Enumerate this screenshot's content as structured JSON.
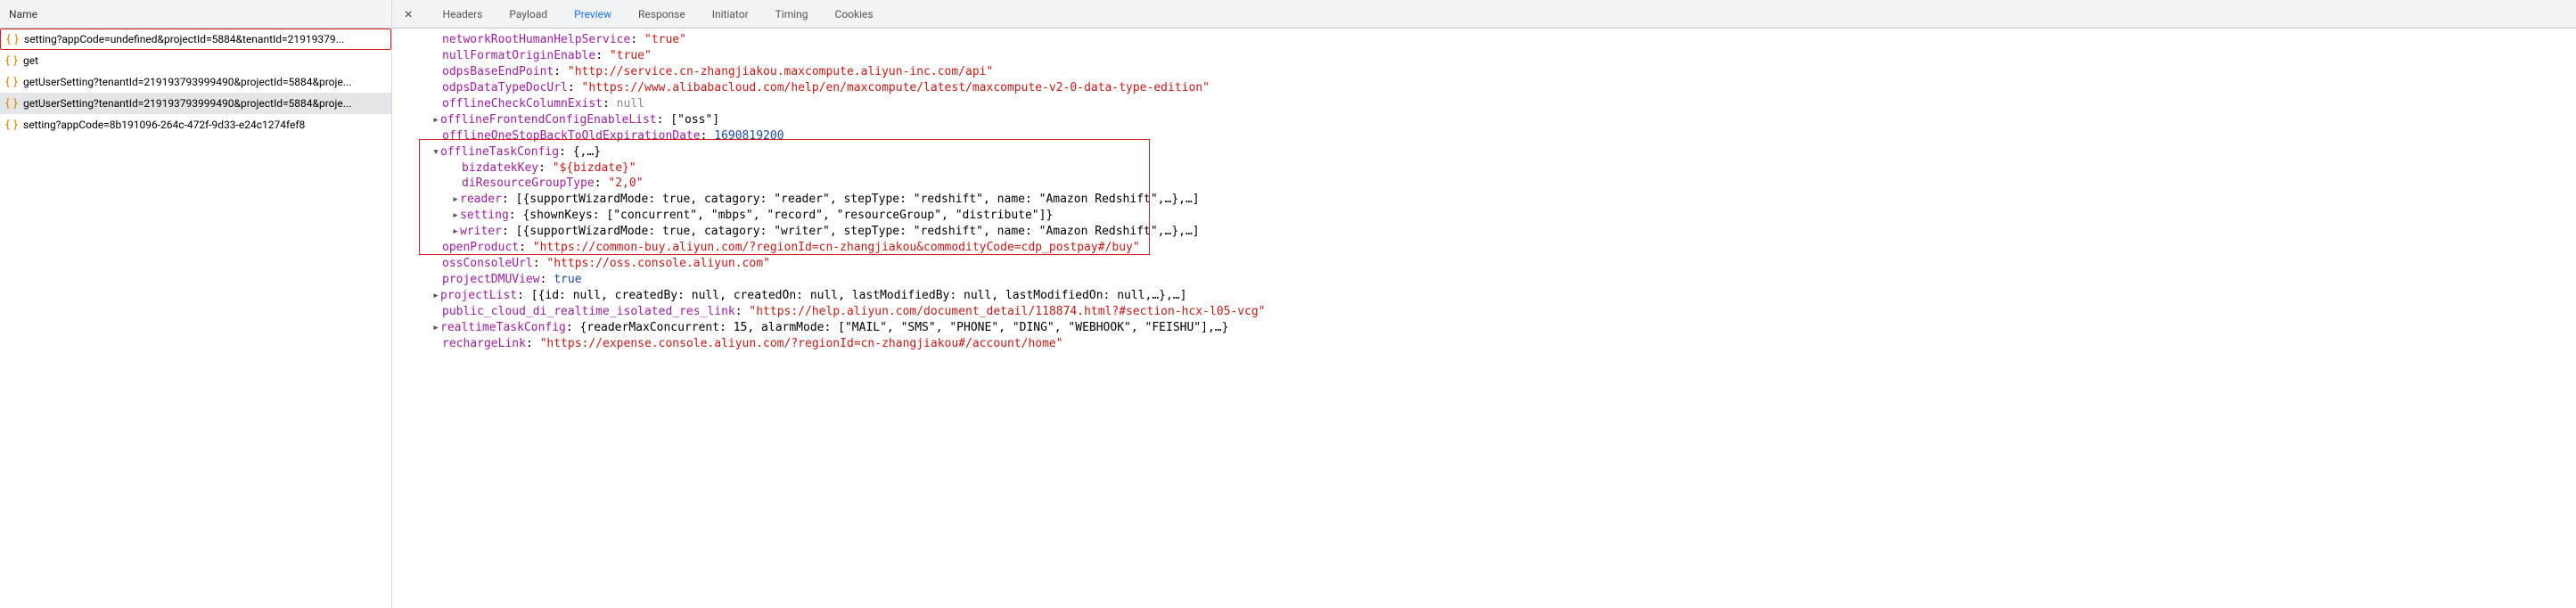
{
  "leftHeader": "Name",
  "requests": [
    {
      "name": "setting?appCode=undefined&projectId=5884&tenantId=21919379..."
    },
    {
      "name": "get"
    },
    {
      "name": "getUserSetting?tenantId=219193793999490&projectId=5884&proje..."
    },
    {
      "name": "getUserSetting?tenantId=219193793999490&projectId=5884&proje..."
    },
    {
      "name": "setting?appCode=8b191096-264c-472f-9d33-e24c1274fef8"
    }
  ],
  "tabs": [
    "Headers",
    "Payload",
    "Preview",
    "Response",
    "Initiator",
    "Timing",
    "Cookies"
  ],
  "closeGlyph": "×",
  "tree": {
    "networkRootHumanHelpService": "true",
    "nullFormatOriginEnable": "true",
    "odpsBaseEndPoint": "http://service.cn-zhangjiakou.maxcompute.aliyun-inc.com/api",
    "odpsDataTypeDocUrl": "https://www.alibabacloud.com/help/en/maxcompute/latest/maxcompute-v2-0-data-type-edition",
    "offlineCheckColumnExist": "null",
    "offlineFrontendConfigEnableList": "[\"oss\"]",
    "offlineOneStopBackToOldExpirationDate": "1690819200",
    "offlineTaskConfig": "{,…}",
    "bizdatekKey": "${bizdate}",
    "diResourceGroupType": "2,0",
    "reader": "[{supportWizardMode: true, catagory: \"reader\", stepType: \"redshift\", name: \"Amazon Redshift\",…},…]",
    "setting": "{shownKeys: [\"concurrent\", \"mbps\", \"record\", \"resourceGroup\", \"distribute\"]}",
    "writer": "[{supportWizardMode: true, catagory: \"writer\", stepType: \"redshift\", name: \"Amazon Redshift\",…},…]",
    "openProduct": "https://common-buy.aliyun.com/?regionId=cn-zhangjiakou&commodityCode=cdp_postpay#/buy",
    "ossConsoleUrl": "https://oss.console.aliyun.com",
    "projectDMUView": "true",
    "projectList": "[{id: null, createdBy: null, createdOn: null, lastModifiedBy: null, lastModifiedOn: null,…},…]",
    "public_cloud_di_realtime_isolated_res_link": "https://help.aliyun.com/document_detail/118874.html?#section-hcx-l05-vcg",
    "realtimeTaskConfig": "{readerMaxConcurrent: 15, alarmMode: [\"MAIL\", \"SMS\", \"PHONE\", \"DING\", \"WEBHOOK\", \"FEISHU\"],…}",
    "rechargeLink": "https://expense.console.aliyun.com/?regionId=cn-zhangjiakou#/account/home"
  }
}
